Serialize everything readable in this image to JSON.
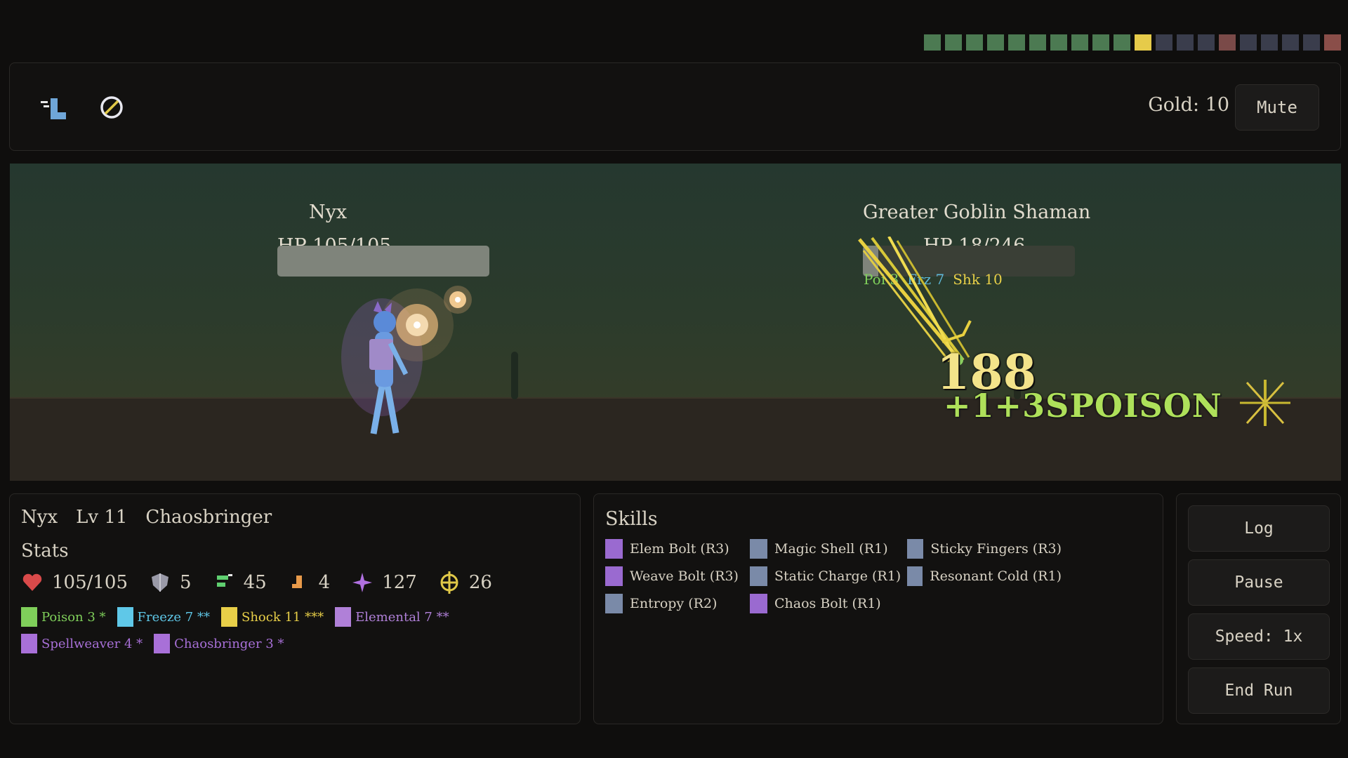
{
  "progress": {
    "squares": [
      "#4c7a52",
      "#4c7a52",
      "#4c7a52",
      "#4c7a52",
      "#4c7a52",
      "#4c7a52",
      "#4c7a52",
      "#4c7a52",
      "#4c7a52",
      "#4c7a52",
      "#e6cb4a",
      "#3a3d4c",
      "#3a3d4c",
      "#3a3d4c",
      "#7a4a48",
      "#3a3d4c",
      "#3a3d4c",
      "#3a3d4c",
      "#3a3d4c",
      "#8a4e49"
    ]
  },
  "topbar": {
    "icons": [
      "boot-icon",
      "block-icon"
    ],
    "gold_label": "Gold: 10",
    "mute_label": "Mute"
  },
  "scene": {
    "player": {
      "name": "Nyx",
      "hp_label": "HP 105/105",
      "hp_fraction": 1.0
    },
    "enemy": {
      "name": "Greater Goblin Shaman",
      "hp_label": "HP 18/246",
      "hp_fraction": 0.073,
      "statuses": [
        {
          "text": "Poi 3",
          "color": "#7fcf5a"
        },
        {
          "text": "Frz 7",
          "color": "#5fb8d8"
        },
        {
          "text": "Shk 10",
          "color": "#e8cf48"
        }
      ]
    },
    "damage_text": "188",
    "damage_sub_text": "+1+3SPOISON"
  },
  "character": {
    "name": "Nyx",
    "level": "Lv 11",
    "class": "Chaosbringer",
    "stats_title": "Stats",
    "stats": [
      {
        "icon": "heart-icon",
        "value": "105/105",
        "color": "#d94a4a"
      },
      {
        "icon": "shield-icon",
        "value": "5",
        "color": "#9a9aa8"
      },
      {
        "icon": "speed-icon",
        "value": "45",
        "color": "#5fcf70"
      },
      {
        "icon": "boot-icon",
        "value": "4",
        "color": "#e89a4a"
      },
      {
        "icon": "sparkle-icon",
        "value": "127",
        "color": "#b070e0"
      },
      {
        "icon": "crosshair-icon",
        "value": "26",
        "color": "#e0c848"
      }
    ],
    "tags": [
      {
        "label": "Poison 3 *",
        "color": "#7fcf5a"
      },
      {
        "label": "Freeze 7 **",
        "color": "#5fc8e8"
      },
      {
        "label": "Shock 11 ***",
        "color": "#e8cf48"
      },
      {
        "label": "Elemental 7 **",
        "color": "#b080d8"
      },
      {
        "label": "Spellweaver 4 *",
        "color": "#a870d8"
      },
      {
        "label": "Chaosbringer 3 *",
        "color": "#a870d8"
      }
    ]
  },
  "skills": {
    "title": "Skills",
    "items": [
      {
        "label": "Elem Bolt (R3)",
        "color": "#9a6ad0"
      },
      {
        "label": "Magic Shell (R1)",
        "color": "#7a8aa8"
      },
      {
        "label": "Sticky Fingers (R3)",
        "color": "#7a8aa8"
      },
      {
        "label": "Weave Bolt (R3)",
        "color": "#9a6ad0"
      },
      {
        "label": "Static Charge (R1)",
        "color": "#7a8aa8"
      },
      {
        "label": "Resonant Cold (R1)",
        "color": "#7a8aa8"
      },
      {
        "label": "Entropy (R2)",
        "color": "#7a8aa8"
      },
      {
        "label": "Chaos Bolt (R1)",
        "color": "#9a6ad0"
      }
    ]
  },
  "controls": {
    "log_label": "Log",
    "pause_label": "Pause",
    "speed_label": "Speed: 1x",
    "end_label": "End Run"
  }
}
